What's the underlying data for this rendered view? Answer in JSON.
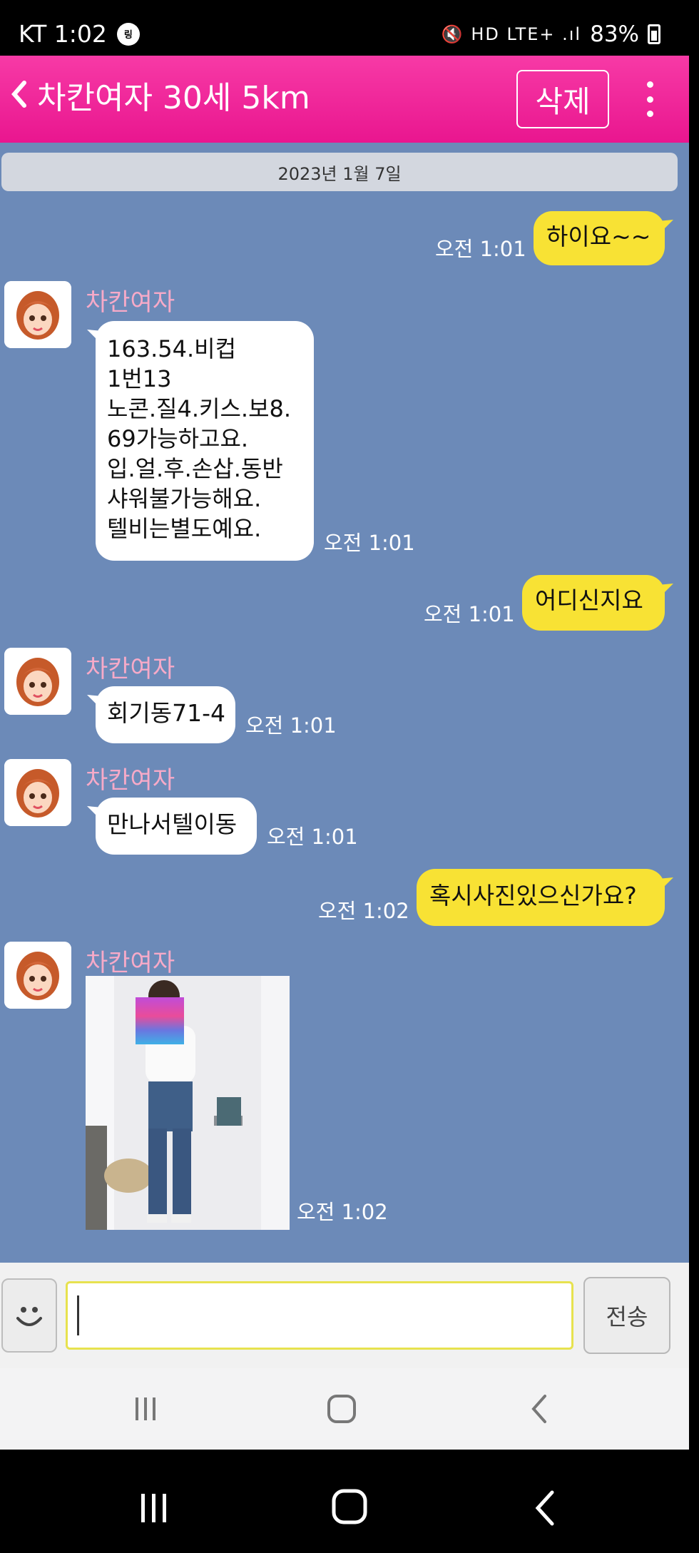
{
  "status_bar": {
    "carrier_time": "KT 1:02",
    "badge": "링",
    "icons": "🔇 HD LTE+ .ıl",
    "battery": "83%"
  },
  "header": {
    "back_symbol": "<",
    "title": "차칸여자 30세 5km",
    "delete_label": "삭제"
  },
  "chat": {
    "date": "2023년 1월 7일",
    "sender_name": "차칸여자",
    "messages": [
      {
        "from": "me",
        "text": "하이요~~",
        "time": "오전 1:01"
      },
      {
        "from": "them",
        "text": "163.54.비컵\n1번13\n노콘.질4.키스.보8.\n69가능하고요.\n입.얼.후.손삽.동반\n샤워불가능해요.\n텔비는별도예요.",
        "time": "오전 1:01"
      },
      {
        "from": "me",
        "text": "어디신지요",
        "time": "오전 1:01"
      },
      {
        "from": "them",
        "text": "회기동71-4",
        "time": "오전 1:01"
      },
      {
        "from": "them",
        "text": "만나서텔이동",
        "time": "오전 1:01"
      },
      {
        "from": "me",
        "text": "혹시사진있으신가요?",
        "time": "오전 1:02"
      },
      {
        "from": "them",
        "text": "",
        "time": "오전 1:02"
      }
    ]
  },
  "input": {
    "value": "",
    "placeholder": "",
    "send_label": "전송"
  },
  "colors": {
    "header": "#e9168f",
    "chat_bg": "#6c8ab8",
    "my_bubble": "#f8e234",
    "name": "#f7aac8"
  },
  "icons": {
    "emoji": "smiley-icon",
    "menu": "kebab-menu-icon",
    "back": "chevron-left-icon"
  }
}
